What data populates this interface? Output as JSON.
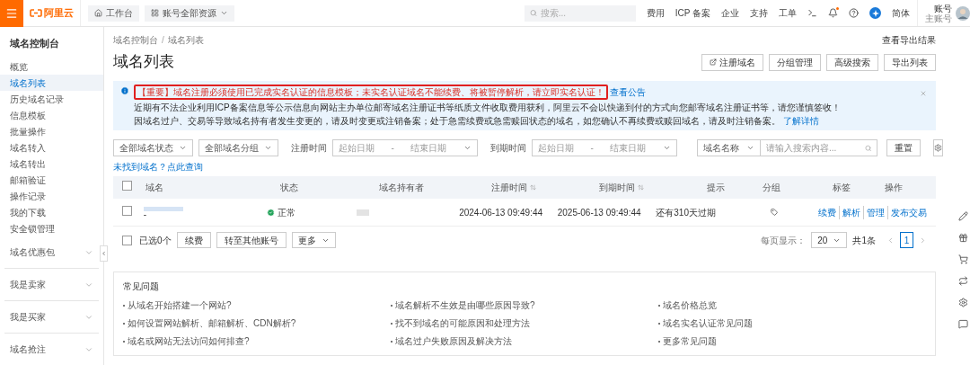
{
  "topbar": {
    "logo": "阿里云",
    "workbench": "工作台",
    "resources": "账号全部资源",
    "search": {
      "placeholder": "搜索..."
    },
    "links": [
      "费用",
      "ICP 备案",
      "企业",
      "支持",
      "工单"
    ],
    "notification_dot": true,
    "language": "简体",
    "account": {
      "name": "账号",
      "role": "主账号"
    }
  },
  "sidebar": {
    "title": "域名控制台",
    "items": [
      {
        "label": "概览",
        "selected": false
      },
      {
        "label": "域名列表",
        "selected": true
      },
      {
        "label": "历史域名记录",
        "selected": false
      },
      {
        "label": "信息模板",
        "selected": false
      },
      {
        "label": "批量操作",
        "selected": false
      },
      {
        "label": "域名转入",
        "selected": false
      },
      {
        "label": "域名转出",
        "selected": false
      },
      {
        "label": "邮箱验证",
        "selected": false
      },
      {
        "label": "操作记录",
        "selected": false
      },
      {
        "label": "我的下载",
        "selected": false
      },
      {
        "label": "安全锁管理",
        "selected": false
      }
    ],
    "groups": [
      {
        "label": "域名优惠包",
        "expanded": false
      },
      {
        "label": "我是卖家",
        "expanded": false
      },
      {
        "label": "我是买家",
        "expanded": false
      },
      {
        "label": "域名抢注",
        "expanded": false
      }
    ]
  },
  "breadcrumb": [
    "域名控制台",
    "/",
    "域名列表"
  ],
  "export_results": "查看导出结果",
  "title": "域名列表",
  "actions": [
    "注册域名",
    "分组管理",
    "高级搜索",
    "导出列表"
  ],
  "notice": {
    "important": "【重要】域名注册必须使用已完成实名认证的信息模板；未实名认证域名不能续费、将被暂停解析，请立即实名认证！",
    "link": "查看公告",
    "lines": [
      "近期有不法企业利用ICP备案信息等公示信息向网站主办单位邮寄域名注册证书等纸质文件收取费用获利，阿里云不会以快递到付的方式向您邮寄域名注册证书等，请您谨慎签收！",
      "因域名过户、交易等导致域名持有者发生变更的，请及时变更或注销备案；处于急需续费或急需赎回状态的域名，如您确认不再续费或赎回域名，请及时注销备案。"
    ],
    "more": "了解详情"
  },
  "filters": {
    "status": "全部域名状态",
    "group": "全部域名分组",
    "ranges": [
      {
        "label": "注册时间",
        "start": "起始日期",
        "dash": "-",
        "end": "结束日期"
      },
      {
        "label": "到期时间",
        "start": "起始日期",
        "dash": "-",
        "end": "结束日期"
      }
    ],
    "field": "域名名称",
    "search_placeholder": "请输入搜索内容...",
    "reset": "重置"
  },
  "not_found_link": "未找到域名？点此查询",
  "table": {
    "columns": [
      "域名",
      "状态",
      "域名持有者",
      "注册时间",
      "到期时间",
      "提示",
      "分组",
      "标签",
      "操作"
    ],
    "rows": [
      {
        "checked": false,
        "domain_suffix": "-",
        "status": "正常",
        "registered": "2024-06-13 09:49:44",
        "expires": "2025-06-13 09:49:44",
        "hint": "还有310天过期",
        "ops": [
          "续费",
          "解析",
          "管理",
          "发布交易"
        ]
      }
    ]
  },
  "footer": {
    "selected_all": false,
    "selected_count": "已选0个",
    "buttons": [
      "续费",
      "转至其他账号"
    ],
    "more": "更多",
    "page_size_label": "每页显示：",
    "page_size": "20",
    "total": "共1条",
    "page": "1"
  },
  "faq": {
    "title": "常见问题",
    "columns": [
      [
        "从域名开始搭建一个网站?",
        "如何设置网站解析、邮箱解析、CDN解析?",
        "域名或网站无法访问如何排查?"
      ],
      [
        "域名解析不生效是由哪些原因导致?",
        "找不到域名的可能原因和处理方法",
        "域名过户失败原因及解决方法"
      ],
      [
        "域名价格总览",
        "域名实名认证常见问题",
        "更多常见问题"
      ]
    ]
  }
}
